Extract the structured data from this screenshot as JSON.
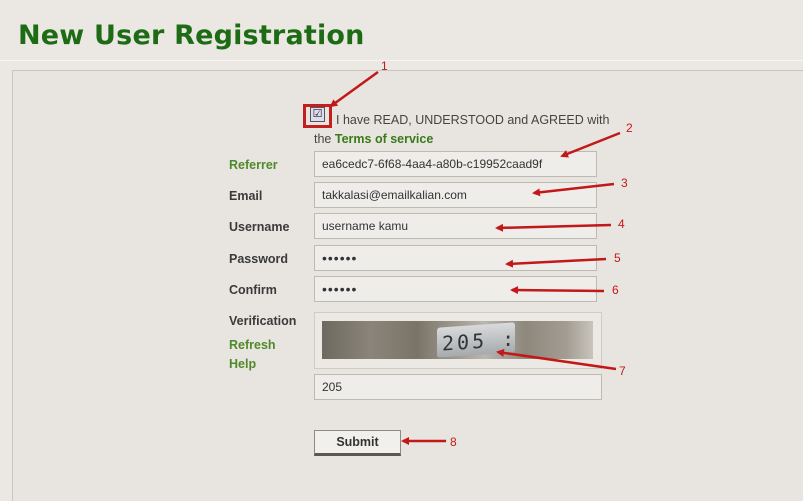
{
  "header": {
    "title": "New User Registration"
  },
  "agreement": {
    "checked_glyph": "☑",
    "text_line1": "I have READ, UNDERSTOOD and AGREED with",
    "text_prefix": "the",
    "link": "Terms of service"
  },
  "form": {
    "referrer": {
      "label": "Referrer",
      "value": "ea6cedc7-6f68-4aa4-a80b-c19952caad9f"
    },
    "email": {
      "label": "Email",
      "value": "takkalasi@emailkalian.com"
    },
    "username": {
      "label": "Username",
      "value": "username kamu"
    },
    "password": {
      "label": "Password",
      "value": "••••••"
    },
    "confirm": {
      "label": "Confirm",
      "value": "••••••"
    },
    "verification": {
      "label": "Verification",
      "refresh_link": "Refresh",
      "help_link": "Help",
      "captcha_text": "205 :",
      "answer": "205"
    },
    "submit_label": "Submit"
  },
  "annotations": [
    "1",
    "2",
    "3",
    "4",
    "5",
    "6",
    "7",
    "8"
  ],
  "colors": {
    "title": "#1d6b14",
    "link": "#3a7a1a",
    "annotation": "#c31818"
  }
}
